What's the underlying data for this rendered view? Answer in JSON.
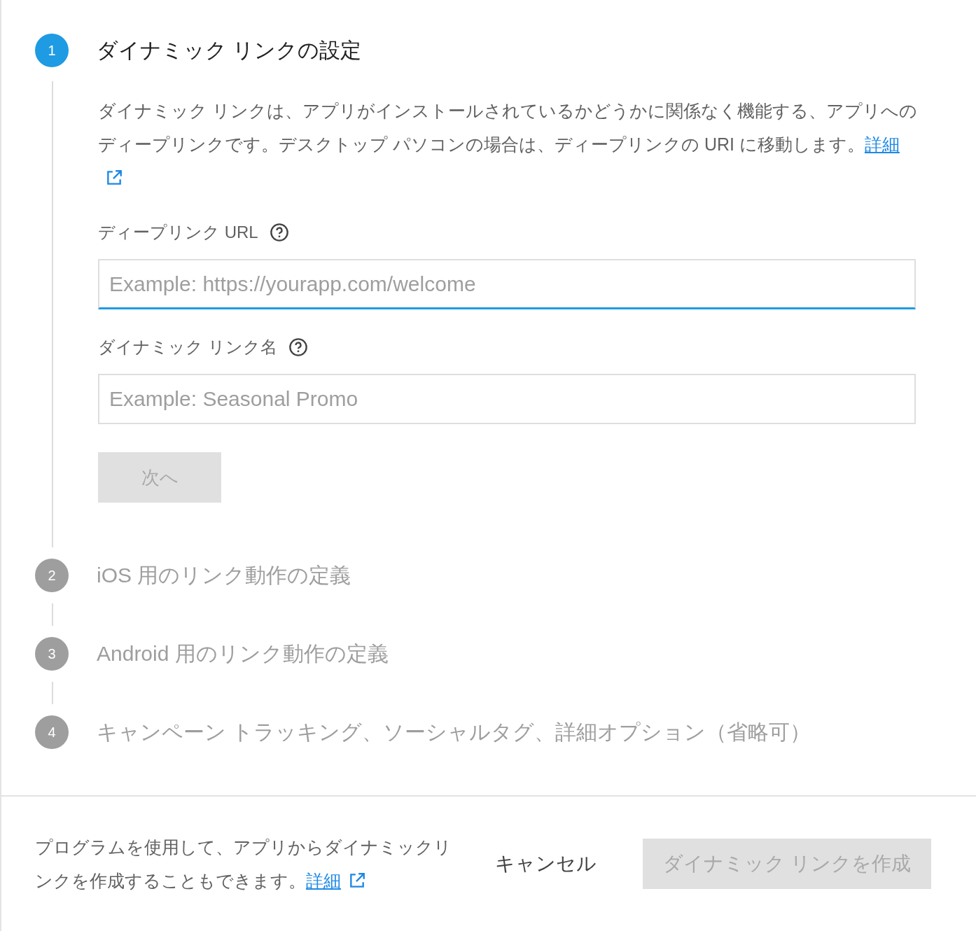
{
  "steps": [
    {
      "number": "1",
      "title": "ダイナミック リンクの設定",
      "active": true,
      "description": "ダイナミック リンクは、アプリがインストールされているかどうかに関係なく機能する、アプリへのディープリンクです。デスクトップ パソコンの場合は、ディープリンクの URI に移動します。",
      "description_link": "詳細",
      "fields": [
        {
          "label": "ディープリンク URL",
          "placeholder": "Example: https://yourapp.com/welcome",
          "focused": true
        },
        {
          "label": "ダイナミック リンク名",
          "placeholder": "Example: Seasonal Promo",
          "focused": false
        }
      ],
      "next_button": {
        "label": "次へ",
        "disabled": true
      }
    },
    {
      "number": "2",
      "title": "iOS 用のリンク動作の定義",
      "active": false
    },
    {
      "number": "3",
      "title": "Android 用のリンク動作の定義",
      "active": false
    },
    {
      "number": "4",
      "title": "キャンペーン トラッキング、ソーシャルタグ、詳細オプション（省略可）",
      "active": false
    }
  ],
  "footer": {
    "text": "プログラムを使用して、アプリからダイナミックリンクを作成することもできます。",
    "link": "詳細",
    "cancel": "キャンセル",
    "create": {
      "label": "ダイナミック リンクを作成",
      "disabled": true
    }
  }
}
